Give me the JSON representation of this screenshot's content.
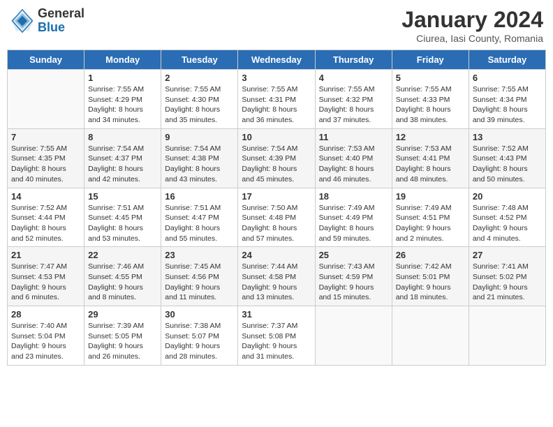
{
  "logo": {
    "general": "General",
    "blue": "Blue"
  },
  "title": "January 2024",
  "subtitle": "Ciurea, Iasi County, Romania",
  "days_of_week": [
    "Sunday",
    "Monday",
    "Tuesday",
    "Wednesday",
    "Thursday",
    "Friday",
    "Saturday"
  ],
  "weeks": [
    [
      {
        "num": "",
        "info": ""
      },
      {
        "num": "1",
        "info": "Sunrise: 7:55 AM\nSunset: 4:29 PM\nDaylight: 8 hours\nand 34 minutes."
      },
      {
        "num": "2",
        "info": "Sunrise: 7:55 AM\nSunset: 4:30 PM\nDaylight: 8 hours\nand 35 minutes."
      },
      {
        "num": "3",
        "info": "Sunrise: 7:55 AM\nSunset: 4:31 PM\nDaylight: 8 hours\nand 36 minutes."
      },
      {
        "num": "4",
        "info": "Sunrise: 7:55 AM\nSunset: 4:32 PM\nDaylight: 8 hours\nand 37 minutes."
      },
      {
        "num": "5",
        "info": "Sunrise: 7:55 AM\nSunset: 4:33 PM\nDaylight: 8 hours\nand 38 minutes."
      },
      {
        "num": "6",
        "info": "Sunrise: 7:55 AM\nSunset: 4:34 PM\nDaylight: 8 hours\nand 39 minutes."
      }
    ],
    [
      {
        "num": "7",
        "info": "Sunrise: 7:55 AM\nSunset: 4:35 PM\nDaylight: 8 hours\nand 40 minutes."
      },
      {
        "num": "8",
        "info": "Sunrise: 7:54 AM\nSunset: 4:37 PM\nDaylight: 8 hours\nand 42 minutes."
      },
      {
        "num": "9",
        "info": "Sunrise: 7:54 AM\nSunset: 4:38 PM\nDaylight: 8 hours\nand 43 minutes."
      },
      {
        "num": "10",
        "info": "Sunrise: 7:54 AM\nSunset: 4:39 PM\nDaylight: 8 hours\nand 45 minutes."
      },
      {
        "num": "11",
        "info": "Sunrise: 7:53 AM\nSunset: 4:40 PM\nDaylight: 8 hours\nand 46 minutes."
      },
      {
        "num": "12",
        "info": "Sunrise: 7:53 AM\nSunset: 4:41 PM\nDaylight: 8 hours\nand 48 minutes."
      },
      {
        "num": "13",
        "info": "Sunrise: 7:52 AM\nSunset: 4:43 PM\nDaylight: 8 hours\nand 50 minutes."
      }
    ],
    [
      {
        "num": "14",
        "info": "Sunrise: 7:52 AM\nSunset: 4:44 PM\nDaylight: 8 hours\nand 52 minutes."
      },
      {
        "num": "15",
        "info": "Sunrise: 7:51 AM\nSunset: 4:45 PM\nDaylight: 8 hours\nand 53 minutes."
      },
      {
        "num": "16",
        "info": "Sunrise: 7:51 AM\nSunset: 4:47 PM\nDaylight: 8 hours\nand 55 minutes."
      },
      {
        "num": "17",
        "info": "Sunrise: 7:50 AM\nSunset: 4:48 PM\nDaylight: 8 hours\nand 57 minutes."
      },
      {
        "num": "18",
        "info": "Sunrise: 7:49 AM\nSunset: 4:49 PM\nDaylight: 8 hours\nand 59 minutes."
      },
      {
        "num": "19",
        "info": "Sunrise: 7:49 AM\nSunset: 4:51 PM\nDaylight: 9 hours\nand 2 minutes."
      },
      {
        "num": "20",
        "info": "Sunrise: 7:48 AM\nSunset: 4:52 PM\nDaylight: 9 hours\nand 4 minutes."
      }
    ],
    [
      {
        "num": "21",
        "info": "Sunrise: 7:47 AM\nSunset: 4:53 PM\nDaylight: 9 hours\nand 6 minutes."
      },
      {
        "num": "22",
        "info": "Sunrise: 7:46 AM\nSunset: 4:55 PM\nDaylight: 9 hours\nand 8 minutes."
      },
      {
        "num": "23",
        "info": "Sunrise: 7:45 AM\nSunset: 4:56 PM\nDaylight: 9 hours\nand 11 minutes."
      },
      {
        "num": "24",
        "info": "Sunrise: 7:44 AM\nSunset: 4:58 PM\nDaylight: 9 hours\nand 13 minutes."
      },
      {
        "num": "25",
        "info": "Sunrise: 7:43 AM\nSunset: 4:59 PM\nDaylight: 9 hours\nand 15 minutes."
      },
      {
        "num": "26",
        "info": "Sunrise: 7:42 AM\nSunset: 5:01 PM\nDaylight: 9 hours\nand 18 minutes."
      },
      {
        "num": "27",
        "info": "Sunrise: 7:41 AM\nSunset: 5:02 PM\nDaylight: 9 hours\nand 21 minutes."
      }
    ],
    [
      {
        "num": "28",
        "info": "Sunrise: 7:40 AM\nSunset: 5:04 PM\nDaylight: 9 hours\nand 23 minutes."
      },
      {
        "num": "29",
        "info": "Sunrise: 7:39 AM\nSunset: 5:05 PM\nDaylight: 9 hours\nand 26 minutes."
      },
      {
        "num": "30",
        "info": "Sunrise: 7:38 AM\nSunset: 5:07 PM\nDaylight: 9 hours\nand 28 minutes."
      },
      {
        "num": "31",
        "info": "Sunrise: 7:37 AM\nSunset: 5:08 PM\nDaylight: 9 hours\nand 31 minutes."
      },
      {
        "num": "",
        "info": ""
      },
      {
        "num": "",
        "info": ""
      },
      {
        "num": "",
        "info": ""
      }
    ]
  ]
}
